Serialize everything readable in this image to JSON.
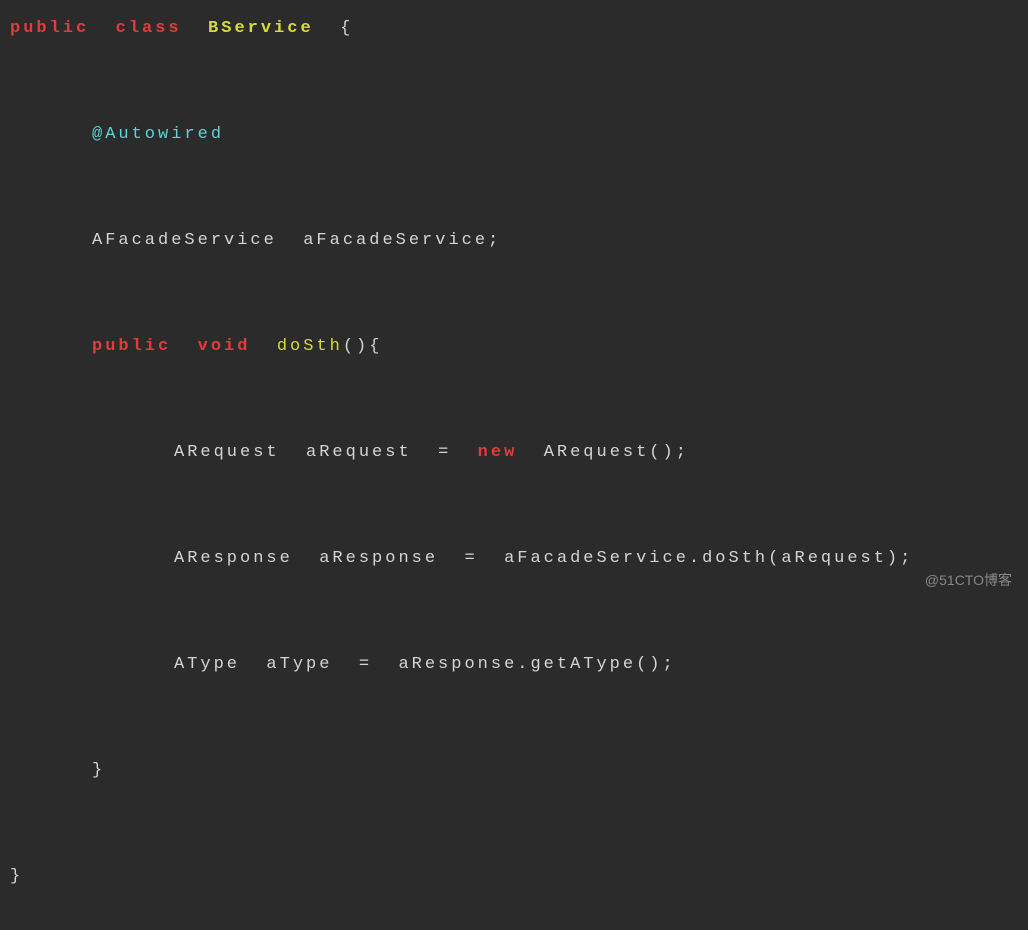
{
  "code": {
    "line1": {
      "kw_public": "public",
      "kw_class": "class",
      "classname": "BService",
      "brace": "{"
    },
    "line2": {
      "annotation": "@Autowired"
    },
    "line3": {
      "type": "AFacadeService",
      "var": "aFacadeService;"
    },
    "line4": {
      "kw_public": "public",
      "kw_void": "void",
      "method": "doSth",
      "parens_brace": "(){"
    },
    "line5": {
      "type": "ARequest",
      "var": "aRequest",
      "eq": "=",
      "kw_new": "new",
      "ctor": "ARequest();"
    },
    "line6": {
      "type": "AResponse",
      "var": "aResponse",
      "eq": "=",
      "expr": "aFacadeService.doSth(aRequest);"
    },
    "line7": {
      "type": "AType",
      "var": "aType",
      "eq": "=",
      "expr": "aResponse.getAType();"
    },
    "line8": {
      "brace": "}"
    },
    "line9": {
      "brace": "}"
    }
  },
  "watermark": "@51CTO博客"
}
